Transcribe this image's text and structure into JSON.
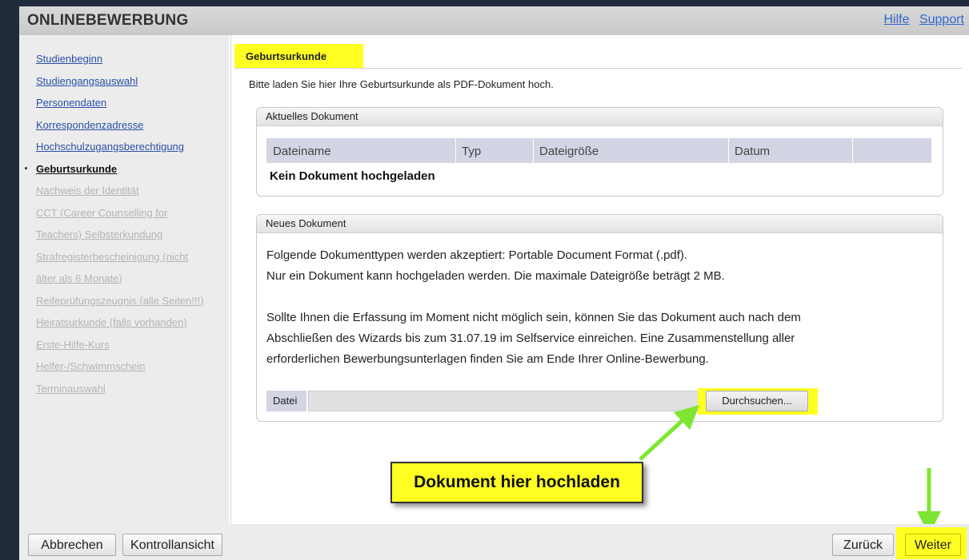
{
  "header": {
    "title": "ONLINEBEWERBUNG",
    "links": [
      "Hilfe",
      "Support"
    ]
  },
  "sidebar": {
    "items": [
      {
        "label": "Studienbeginn",
        "state": "link"
      },
      {
        "label": "Studiengangsauswahl",
        "state": "link"
      },
      {
        "label": "Personendaten",
        "state": "link"
      },
      {
        "label": "Korrespondenzadresse",
        "state": "link"
      },
      {
        "label": "Hochschulzugangsberechtigung",
        "state": "link"
      },
      {
        "label": "Geburtsurkunde",
        "state": "active"
      },
      {
        "label": "Nachweis der Identität",
        "state": "disabled"
      },
      {
        "label": "CCT (Career Counselling for",
        "state": "disabled"
      },
      {
        "label": "Teachers) Selbsterkundung",
        "state": "disabled"
      },
      {
        "label": "Strafregisterbescheinigung (nicht",
        "state": "disabled"
      },
      {
        "label": "älter als 6 Monate)",
        "state": "disabled"
      },
      {
        "label": "Reifeprüfungszeugnis (alle Seiten!!!)",
        "state": "disabled"
      },
      {
        "label": "Heiratsurkunde (falls vorhanden)",
        "state": "disabled"
      },
      {
        "label": "Erste-Hilfe-Kurs",
        "state": "disabled"
      },
      {
        "label": "Helfer-/Schwimmschein",
        "state": "disabled"
      },
      {
        "label": "Terminauswahl",
        "state": "disabled"
      }
    ]
  },
  "main": {
    "tab_label": "Geburtsurkunde",
    "intro": "Bitte laden Sie hier Ihre Geburtsurkunde als PDF-Dokument hoch.",
    "current_doc": {
      "title": "Aktuelles Dokument",
      "columns": [
        "Dateiname",
        "Typ",
        "Dateigröße",
        "Datum",
        ""
      ],
      "empty_text": "Kein Dokument hochgeladen"
    },
    "new_doc": {
      "title": "Neues Dokument",
      "line1": "Folgende Dokumenttypen werden akzeptiert: Portable Document Format (.pdf).",
      "line2": "Nur ein Dokument kann hochgeladen werden. Die maximale Dateigröße beträgt 2 MB.",
      "line3": "Sollte Ihnen die Erfassung im Moment nicht möglich sein, können Sie das Dokument auch nach dem",
      "line4": "Abschließen des Wizards bis zum 31.07.19 im Selfservice einreichen. Eine Zusammenstellung aller",
      "line5": "erforderlichen Bewerbungsunterlagen finden Sie am Ende Ihrer Online-Bewerbung.",
      "file_label": "Datei",
      "file_value": "",
      "browse_label": "Durchsuchen..."
    }
  },
  "annotation": {
    "callout": "Dokument hier hochladen",
    "highlight_color": "#ffff22",
    "arrow_color": "#7ee632"
  },
  "footer": {
    "cancel": "Abbrechen",
    "overview": "Kontrollansicht",
    "back": "Zurück",
    "next": "Weiter"
  }
}
